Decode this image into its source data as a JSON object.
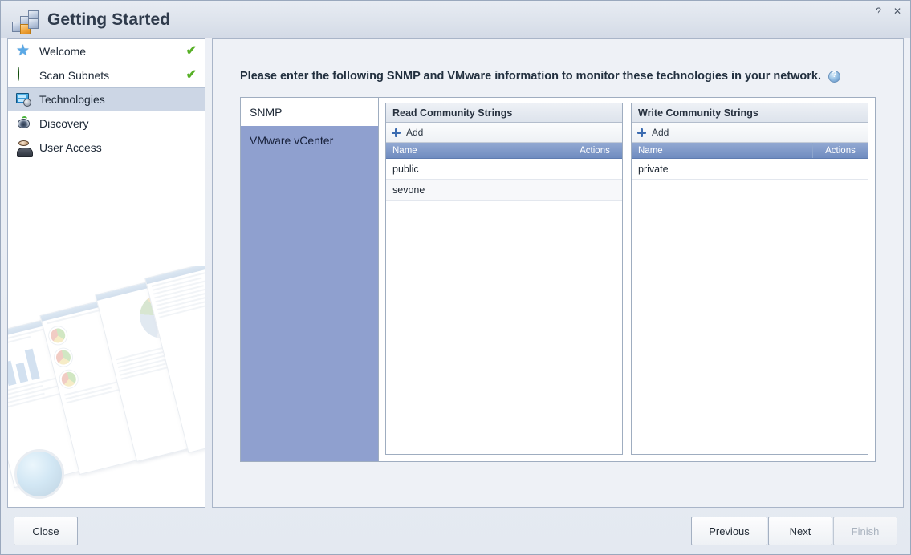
{
  "window": {
    "title": "Getting Started",
    "app_icon": "blocks-stack-icon",
    "controls": {
      "help": "?",
      "close": "✕"
    }
  },
  "sidebar": {
    "items": [
      {
        "label": "Welcome",
        "icon": "star-icon",
        "completed": true,
        "selected": false,
        "check": "✔"
      },
      {
        "label": "Scan Subnets",
        "icon": "green-globe-icon",
        "completed": true,
        "selected": false,
        "check": "✔"
      },
      {
        "label": "Technologies",
        "icon": "monitor-gear-icon",
        "completed": false,
        "selected": true,
        "check": ""
      },
      {
        "label": "Discovery",
        "icon": "radar-eye-icon",
        "completed": false,
        "selected": false,
        "check": ""
      },
      {
        "label": "User Access",
        "icon": "user-icon",
        "completed": false,
        "selected": false,
        "check": ""
      }
    ]
  },
  "main": {
    "instruction": "Please enter the following SNMP and VMware information to monitor these technologies in your network.",
    "help_icon": "help-circle-icon",
    "tabs": [
      {
        "label": "SNMP",
        "active": true
      },
      {
        "label": "VMware vCenter",
        "active": false
      }
    ],
    "grids": [
      {
        "title": "Read Community Strings",
        "toolbar": {
          "add_label": "Add",
          "add_icon": "plus-icon"
        },
        "columns": [
          "Name",
          "Actions"
        ],
        "rows": [
          {
            "name": "public",
            "actions": ""
          },
          {
            "name": "sevone",
            "actions": ""
          }
        ]
      },
      {
        "title": "Write Community Strings",
        "toolbar": {
          "add_label": "Add",
          "add_icon": "plus-icon"
        },
        "columns": [
          "Name",
          "Actions"
        ],
        "rows": [
          {
            "name": "private",
            "actions": ""
          }
        ]
      }
    ]
  },
  "footer": {
    "close": "Close",
    "previous": "Previous",
    "next": "Next",
    "finish": "Finish",
    "finish_disabled": true
  },
  "colors": {
    "accent_blue": "#6f8cc0",
    "tab_selected_blue": "#8fa0cf",
    "sidebar_selected": "#ccd6e5",
    "check_green": "#57b026",
    "plus_blue": "#3b6bb0",
    "window_bg": "#eef1f6"
  }
}
